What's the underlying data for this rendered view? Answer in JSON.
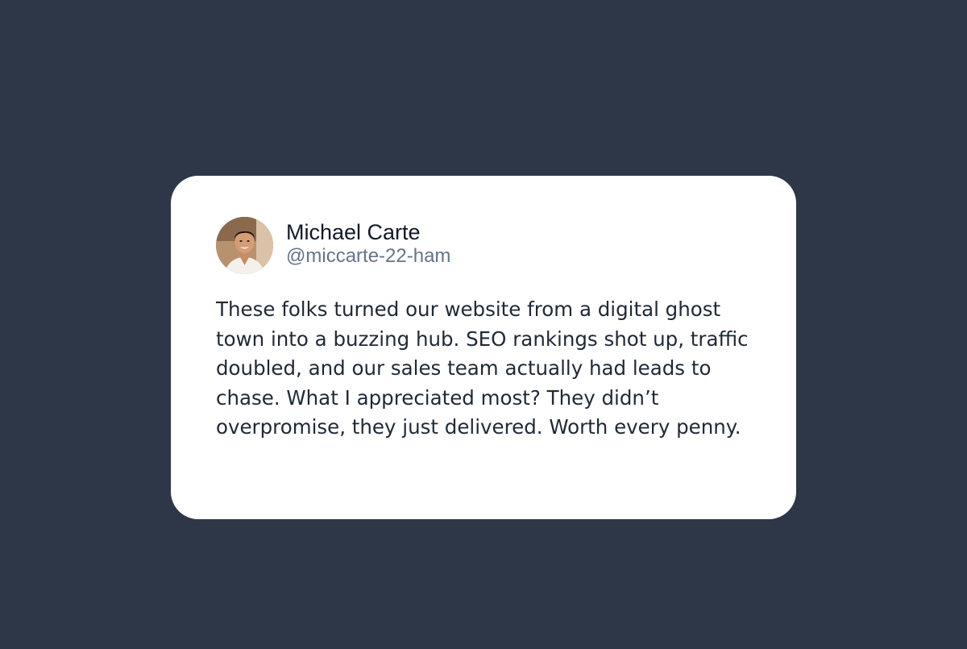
{
  "testimonial": {
    "author_name": "Michael Carte",
    "author_handle": "@miccarte-22-ham",
    "avatar_icon": "avatar-photo-icon",
    "text": "These folks turned our website from a digital ghost town into a buzzing hub. SEO rankings shot up, traffic doubled, and our sales team actually had leads to chase. What I appreciated most? They didn’t overpromise, they just delivered. Worth every penny."
  },
  "colors": {
    "background": "#2d3748",
    "card": "#ffffff",
    "name": "#111827",
    "handle": "#64748b",
    "body_text": "#1f2937"
  }
}
